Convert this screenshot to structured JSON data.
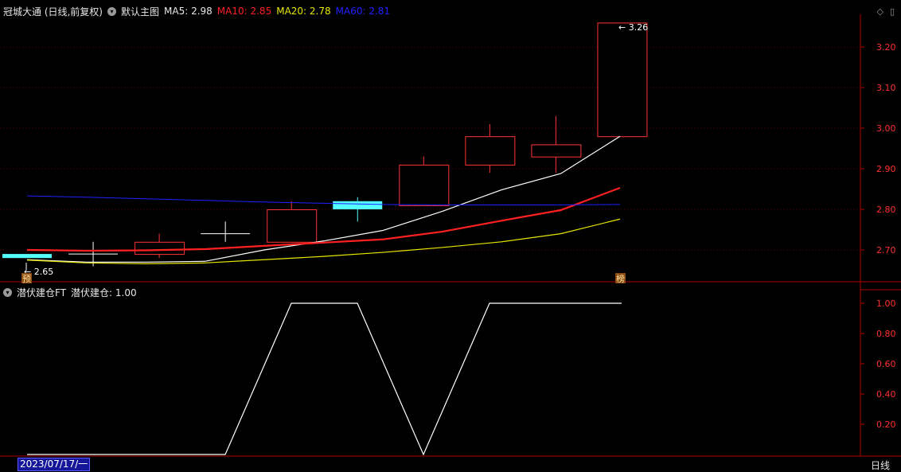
{
  "header": {
    "stock_label": "冠城大通 (日线,前复权)",
    "main_chart_label": "默认主图",
    "ma5_label": "MA5: 2.98",
    "ma10_label": "MA10: 2.85",
    "ma20_label": "MA20: 2.78",
    "ma60_label": "MA60: 2.81"
  },
  "subheader": {
    "indicator_label": "潜伏建仓FT",
    "indicator_value_label": "潜伏建仓: 1.00"
  },
  "footer": {
    "date_cursor": "2023/07/17/一",
    "period_label": "日线"
  },
  "markers": {
    "left": "预",
    "right": "榜"
  },
  "colors": {
    "up": "#ff3232",
    "down": "#54ffff",
    "ma5": "#ffffff",
    "ma10": "#ff2020",
    "ma20": "#e6e600",
    "ma60": "#2020ff",
    "axis": "#b00000",
    "tick_text": "#ff3030"
  },
  "chart_data": [
    {
      "type": "candlestick",
      "title": "冠城大通 (日线,前复权)",
      "xlabel": "",
      "ylabel": "",
      "ylim": [
        2.62,
        3.3
      ],
      "y_ticks": [
        2.7,
        2.8,
        2.9,
        3.0,
        3.1,
        3.2
      ],
      "y_tick_labels": [
        "2.70",
        "2.80",
        "2.90",
        "3.00",
        "3.10",
        "3.20"
      ],
      "grid": true,
      "candles": [
        {
          "open": 2.69,
          "close": 2.68,
          "high": 2.69,
          "low": 2.68
        },
        {
          "open": 2.69,
          "close": 2.69,
          "high": 2.72,
          "low": 2.66
        },
        {
          "open": 2.69,
          "close": 2.72,
          "high": 2.74,
          "low": 2.68
        },
        {
          "open": 2.74,
          "close": 2.74,
          "high": 2.77,
          "low": 2.72
        },
        {
          "open": 2.72,
          "close": 2.8,
          "high": 2.82,
          "low": 2.72
        },
        {
          "open": 2.82,
          "close": 2.8,
          "high": 2.83,
          "low": 2.77
        },
        {
          "open": 2.81,
          "close": 2.91,
          "high": 2.93,
          "low": 2.81
        },
        {
          "open": 2.91,
          "close": 2.98,
          "high": 3.01,
          "low": 2.89
        },
        {
          "open": 2.93,
          "close": 2.96,
          "high": 3.03,
          "low": 2.89
        },
        {
          "open": 2.98,
          "close": 3.26,
          "high": 3.26,
          "low": 2.98
        }
      ],
      "series": [
        {
          "name": "MA5",
          "values": [
            2.676,
            2.67,
            2.67,
            2.672,
            2.7,
            2.722,
            2.748,
            2.795,
            2.848,
            2.888,
            2.98
          ]
        },
        {
          "name": "MA10",
          "values": [
            2.7,
            2.698,
            2.699,
            2.702,
            2.71,
            2.718,
            2.726,
            2.745,
            2.772,
            2.798,
            2.853
          ]
        },
        {
          "name": "MA20",
          "values": [
            2.675,
            2.668,
            2.666,
            2.668,
            2.676,
            2.684,
            2.694,
            2.706,
            2.72,
            2.74,
            2.776
          ]
        },
        {
          "name": "MA60",
          "values": [
            2.833,
            2.83,
            2.826,
            2.822,
            2.818,
            2.815,
            2.812,
            2.811,
            2.811,
            2.811,
            2.812
          ]
        }
      ],
      "annotations": [
        {
          "text": "2.65",
          "at_bar": 0
        },
        {
          "text": "3.26",
          "at_bar": 9
        }
      ]
    },
    {
      "type": "line",
      "title": "潜伏建仓FT",
      "ylim": [
        0.0,
        1.06
      ],
      "y_ticks": [
        0.2,
        0.4,
        0.6,
        0.8,
        1.0
      ],
      "y_tick_labels": [
        "0.20",
        "0.40",
        "0.60",
        "0.80",
        "1.00"
      ],
      "series": [
        {
          "name": "潜伏建仓",
          "values": [
            0,
            0,
            0,
            0,
            1,
            1,
            0,
            1,
            1,
            1
          ]
        }
      ]
    }
  ]
}
